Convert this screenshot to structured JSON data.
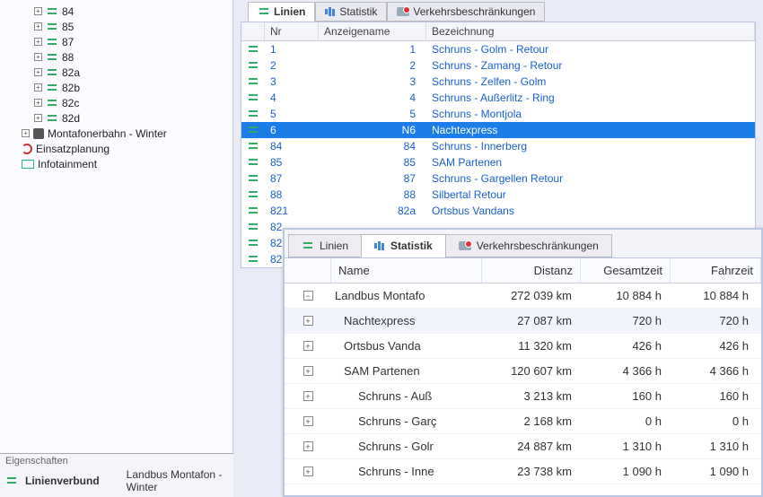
{
  "tree": {
    "routes": [
      {
        "label": "84"
      },
      {
        "label": "85"
      },
      {
        "label": "87"
      },
      {
        "label": "88"
      },
      {
        "label": "82a"
      },
      {
        "label": "82b"
      },
      {
        "label": "82c"
      },
      {
        "label": "82d"
      }
    ],
    "montafon": "Montafonerbahn - Winter",
    "einsatz": "Einsatzplanung",
    "info": "Infotainment"
  },
  "props": {
    "title": "Eigenschaften",
    "col1": "Linienverbund",
    "col2": "Landbus Montafon - Winter"
  },
  "back_tabs": {
    "linien": "Linien",
    "statistik": "Statistik",
    "verkehr": "Verkehrsbeschränkungen"
  },
  "grid_head": {
    "nr": "Nr",
    "anz": "Anzeigename",
    "bez": "Bezeichnung"
  },
  "grid_rows": [
    {
      "nr": "1",
      "anz": "1",
      "bez": "Schruns - Golm - Retour"
    },
    {
      "nr": "2",
      "anz": "2",
      "bez": "Schruns - Zamang - Retour"
    },
    {
      "nr": "3",
      "anz": "3",
      "bez": "Schruns - Zelfen - Golm"
    },
    {
      "nr": "4",
      "anz": "4",
      "bez": "Schruns - Außerlitz - Ring"
    },
    {
      "nr": "5",
      "anz": "5",
      "bez": "Schruns - Montjola"
    },
    {
      "nr": "6",
      "anz": "N6",
      "bez": "Nachtexpress",
      "selected": true
    },
    {
      "nr": "84",
      "anz": "84",
      "bez": "Schruns - Innerberg"
    },
    {
      "nr": "85",
      "anz": "85",
      "bez": "SAM Partenen"
    },
    {
      "nr": "87",
      "anz": "87",
      "bez": "Schruns - Gargellen Retour"
    },
    {
      "nr": "88",
      "anz": "88",
      "bez": "Silbertal Retour"
    },
    {
      "nr": "821",
      "anz": "82a",
      "bez": "Ortsbus Vandans"
    },
    {
      "nr": "82",
      "anz": "",
      "bez": ""
    },
    {
      "nr": "82",
      "anz": "",
      "bez": ""
    },
    {
      "nr": "82",
      "anz": "",
      "bez": ""
    }
  ],
  "stat_tabs": {
    "linien": "Linien",
    "statistik": "Statistik",
    "verkehr": "Verkehrsbeschränkungen"
  },
  "stat_head": {
    "name": "Name",
    "dist": "Distanz",
    "ges": "Gesamtzeit",
    "fahr": "Fahrzeit"
  },
  "chart_data": {
    "type": "table",
    "columns": [
      "Name",
      "Distanz",
      "Gesamtzeit",
      "Fahrzeit"
    ],
    "rows": [
      {
        "exp": "minus",
        "indent": 0,
        "name": "Landbus Montafo",
        "dist": "272 039 km",
        "ges": "10 884 h",
        "fahr": "10 884 h"
      },
      {
        "exp": "plus",
        "indent": 1,
        "name": "Nachtexpress",
        "dist": "27 087 km",
        "ges": "720 h",
        "fahr": "720 h",
        "hover": true
      },
      {
        "exp": "plus",
        "indent": 1,
        "name": "Ortsbus Vanda",
        "dist": "11 320 km",
        "ges": "426 h",
        "fahr": "426 h"
      },
      {
        "exp": "plus",
        "indent": 1,
        "name": "SAM Partenen",
        "dist": "120 607 km",
        "ges": "4 366 h",
        "fahr": "4 366 h"
      },
      {
        "exp": "plus",
        "indent": 2,
        "name": "Schruns - Auß",
        "dist": "3 213 km",
        "ges": "160 h",
        "fahr": "160 h"
      },
      {
        "exp": "plus",
        "indent": 2,
        "name": "Schruns - Garç",
        "dist": "2 168 km",
        "ges": "0 h",
        "fahr": "0 h"
      },
      {
        "exp": "plus",
        "indent": 2,
        "name": "Schruns - Golr",
        "dist": "24 887 km",
        "ges": "1 310 h",
        "fahr": "1 310 h"
      },
      {
        "exp": "plus",
        "indent": 2,
        "name": "Schruns - Inne",
        "dist": "23 738 km",
        "ges": "1 090 h",
        "fahr": "1 090 h"
      }
    ]
  }
}
